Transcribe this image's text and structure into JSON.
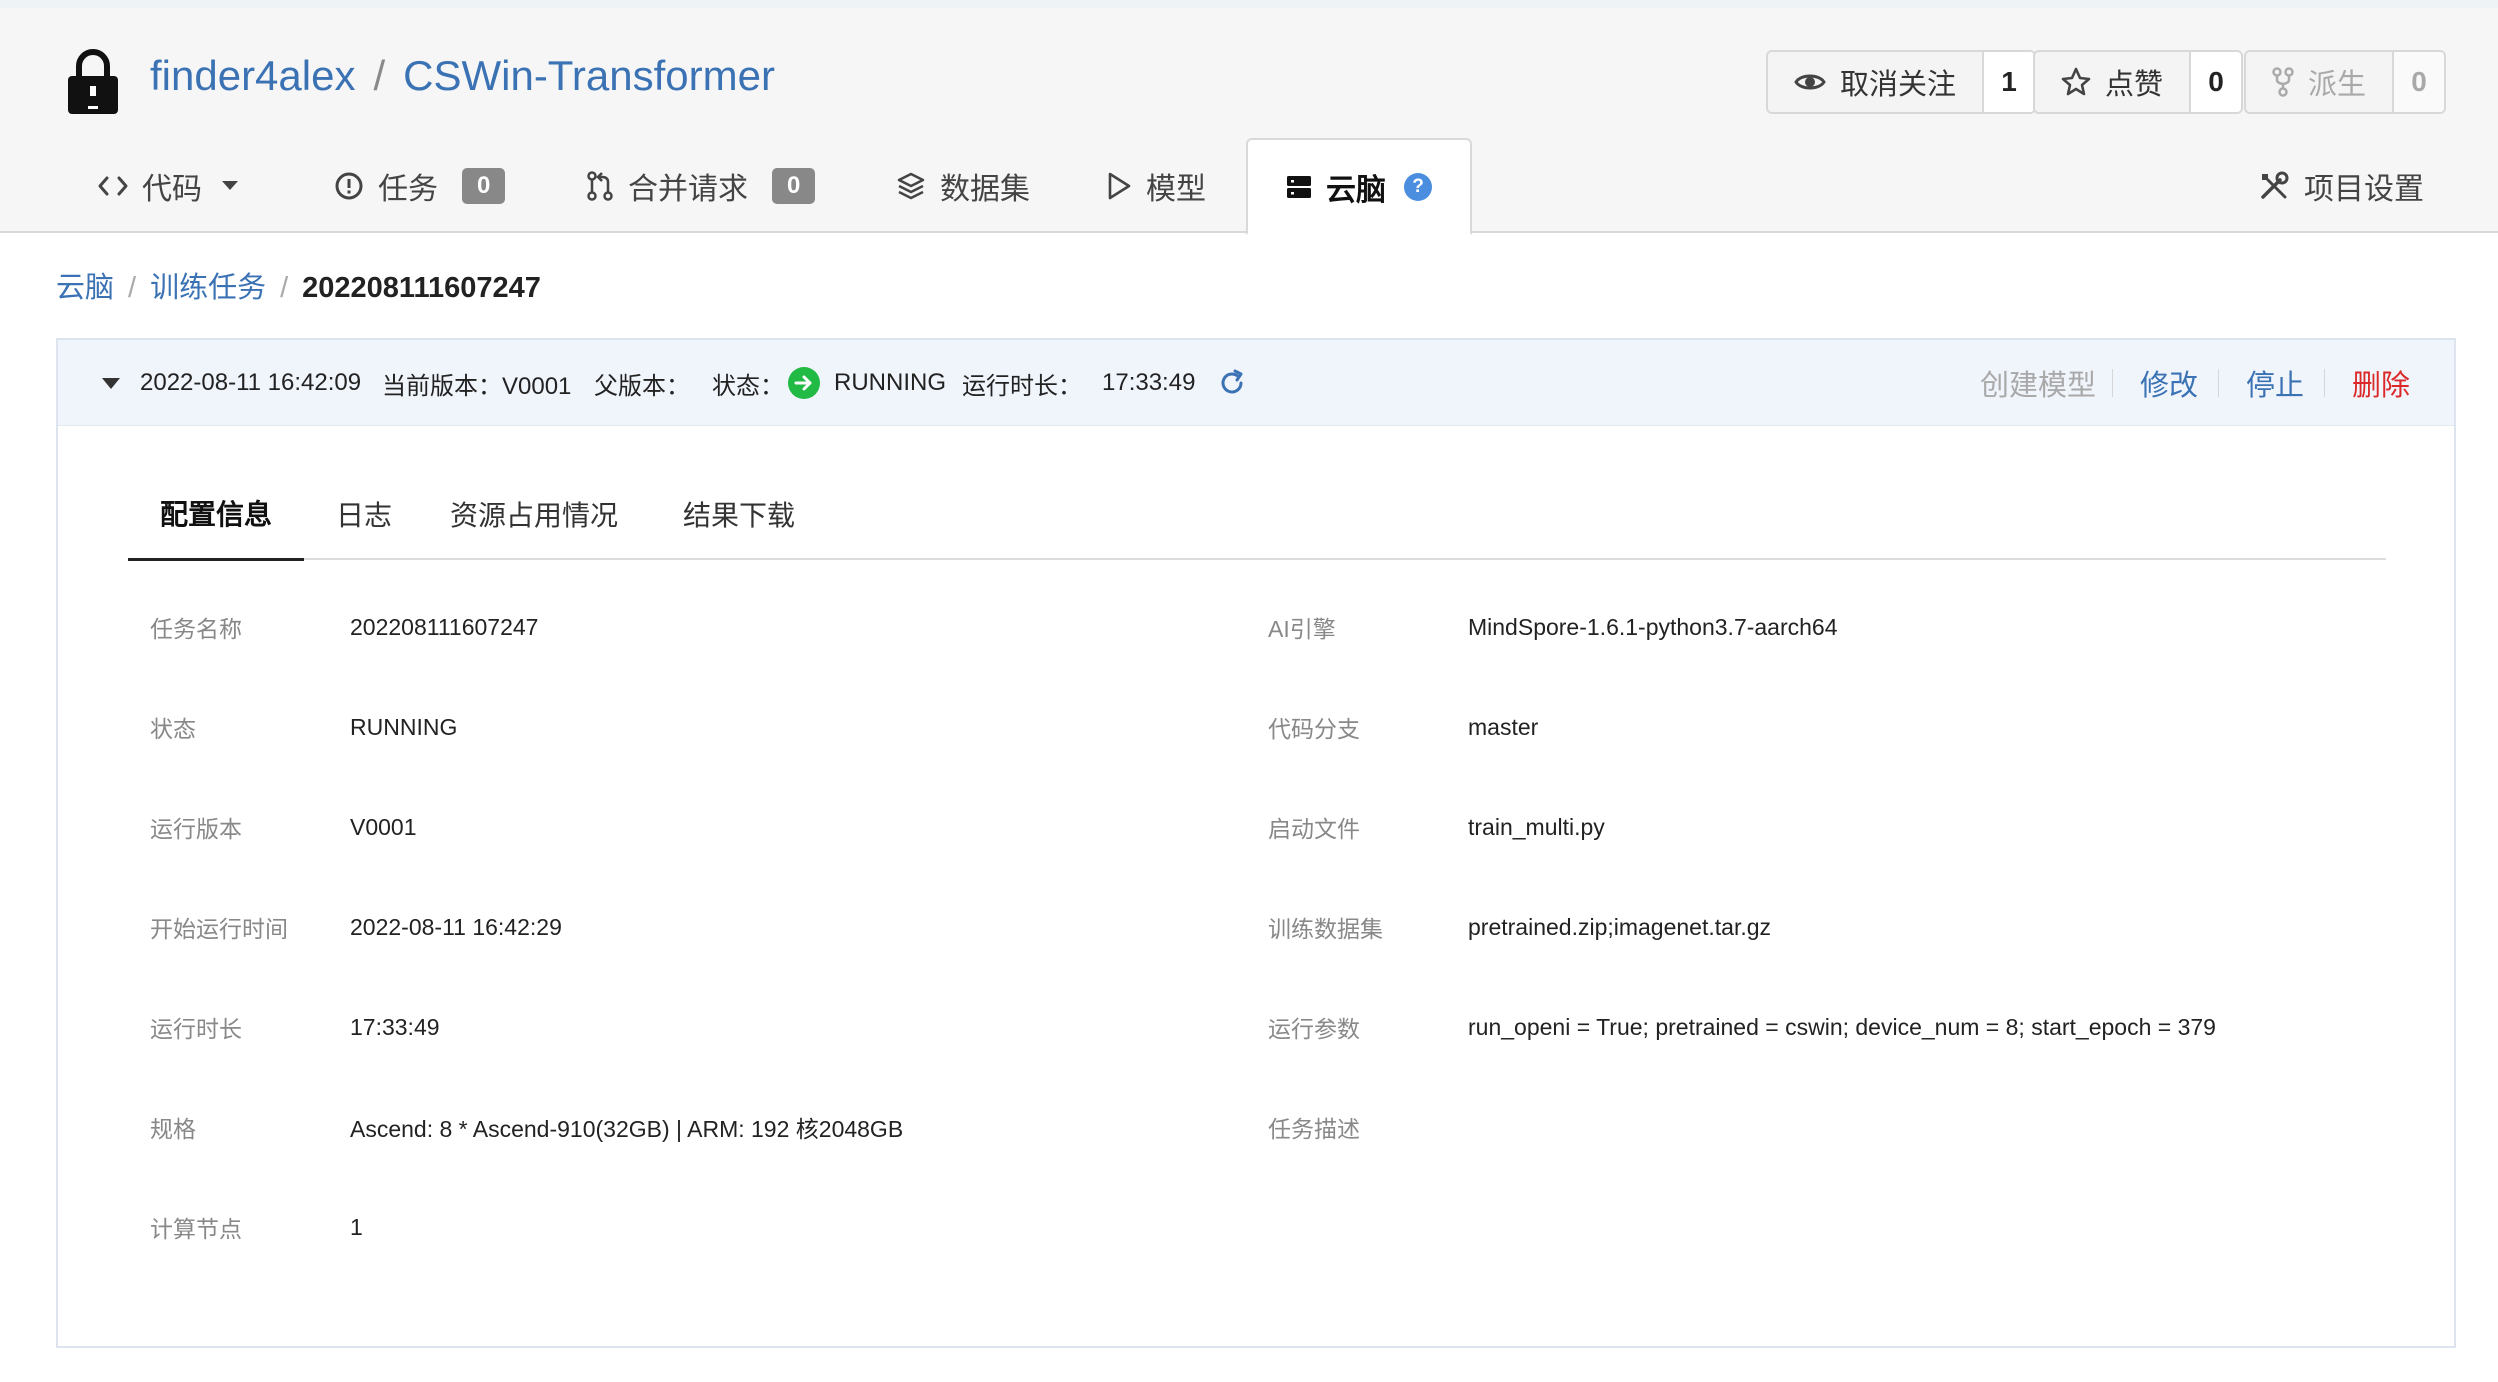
{
  "repo": {
    "owner": "finder4alex",
    "separator": "/",
    "name": "CSWin-Transformer"
  },
  "actions": {
    "watch": {
      "label": "取消关注",
      "count": "1"
    },
    "star": {
      "label": "点赞",
      "count": "0"
    },
    "fork": {
      "label": "派生",
      "count": "0"
    }
  },
  "repo_tabs": {
    "code": {
      "label": "代码"
    },
    "issues": {
      "label": "任务",
      "badge": "0"
    },
    "pulls": {
      "label": "合并请求",
      "badge": "0"
    },
    "datasets": {
      "label": "数据集"
    },
    "models": {
      "label": "模型"
    },
    "cloudbrain": {
      "label": "云脑",
      "help": "?"
    },
    "settings": {
      "label": "项目设置"
    }
  },
  "breadcrumb": {
    "root": "云脑",
    "section": "训练任务",
    "sep": "/",
    "current": "202208111607247"
  },
  "job_bar": {
    "created_at": "2022-08-11 16:42:09",
    "version_label": "当前版本：V0001",
    "parent_version_label": "父版本：",
    "status_label": "状态：",
    "status_value": "RUNNING",
    "duration_label": "运行时长：",
    "duration_value": "17:33:49",
    "ops": {
      "create_model": "创建模型",
      "modify": "修改",
      "stop": "停止",
      "delete": "删除"
    }
  },
  "detail_tabs": {
    "config": "配置信息",
    "logs": "日志",
    "resources": "资源占用情况",
    "download": "结果下载"
  },
  "config_left": [
    {
      "label": "任务名称",
      "value": "202208111607247"
    },
    {
      "label": "状态",
      "value": "RUNNING"
    },
    {
      "label": "运行版本",
      "value": "V0001"
    },
    {
      "label": "开始运行时间",
      "value": "2022-08-11 16:42:29"
    },
    {
      "label": "运行时长",
      "value": "17:33:49"
    },
    {
      "label": "规格",
      "value": "Ascend: 8 * Ascend-910(32GB) | ARM: 192 核2048GB"
    },
    {
      "label": "计算节点",
      "value": "1"
    }
  ],
  "config_right": [
    {
      "label": "AI引擎",
      "value": "MindSpore-1.6.1-python3.7-aarch64"
    },
    {
      "label": "代码分支",
      "value": "master"
    },
    {
      "label": "启动文件",
      "value": "train_multi.py"
    },
    {
      "label": "训练数据集",
      "value": "pretrained.zip;imagenet.tar.gz"
    },
    {
      "label": "运行参数",
      "value": "run_openi = True; pretrained = cswin; device_num = 8; start_epoch = 379"
    },
    {
      "label": "任务描述",
      "value": ""
    }
  ],
  "colors": {
    "link": "#3b72b4",
    "danger": "#db2828",
    "running": "#21ba45",
    "muted": "#a9a9a9"
  },
  "icons": {
    "lock": "lock-icon",
    "watch": "eye-icon",
    "star": "star-icon",
    "fork": "fork-icon",
    "code": "code-icon",
    "issues": "alert-circle-icon",
    "pulls": "pull-request-icon",
    "datasets": "layers-icon",
    "models": "play-outline-icon",
    "cloudbrain": "server-icon",
    "settings": "tools-icon",
    "refresh": "refresh-icon"
  }
}
